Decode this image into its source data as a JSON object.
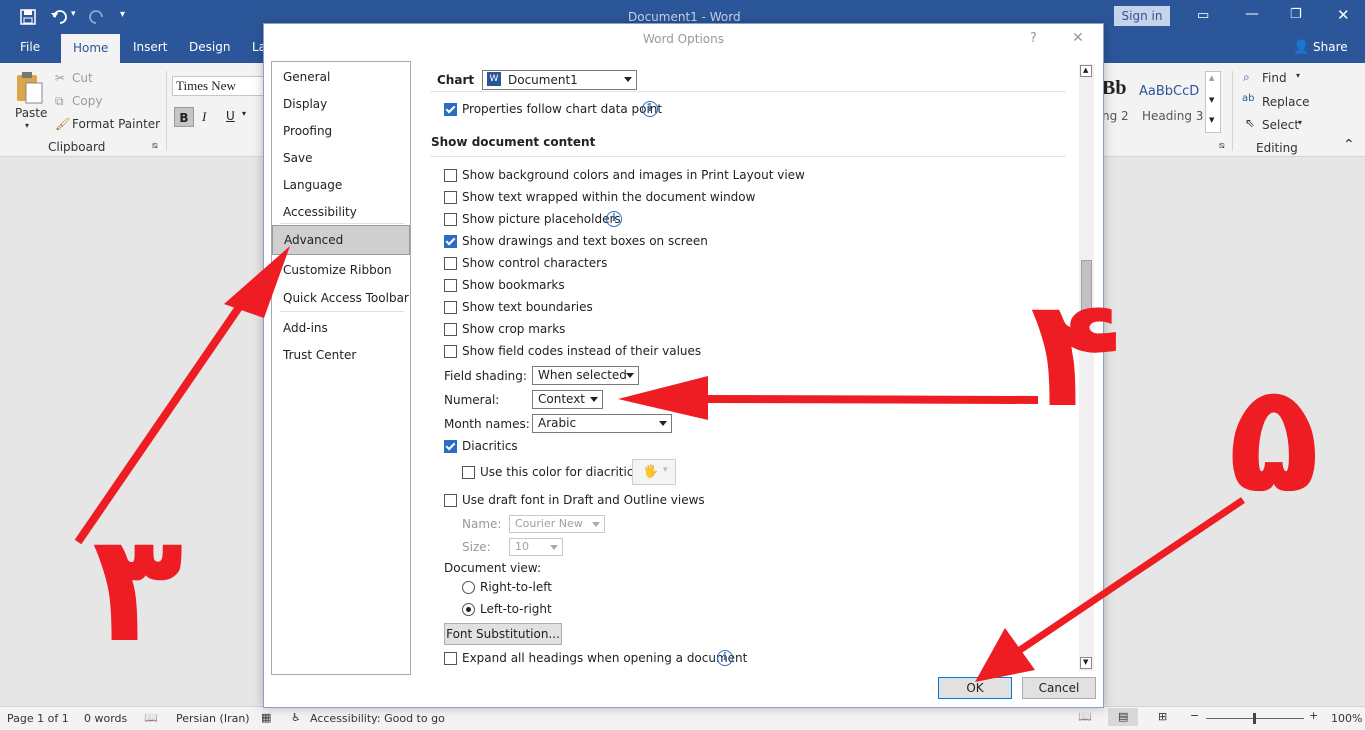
{
  "titlebar": {
    "title": "Document1  -  Word",
    "sign_in": "Sign in"
  },
  "tabs": [
    "File",
    "Home",
    "Insert",
    "Design",
    "La"
  ],
  "share": "Share",
  "ribbon": {
    "paste": "Paste",
    "cut": "Cut",
    "copy": "Copy",
    "format_painter": "Format Painter",
    "clipboard": "Clipboard",
    "font_name": "Times New Rom",
    "bold": "B",
    "italic": "I",
    "underline": "U",
    "style_big": "Bb",
    "style_sample": "AaBbCcD",
    "style_2": "ng 2",
    "style_3": "Heading 3",
    "find": "Find",
    "replace": "Replace",
    "select": "Select",
    "editing": "Editing"
  },
  "dialog": {
    "title": "Word Options",
    "help": "?",
    "close": "✕",
    "nav": [
      "General",
      "Display",
      "Proofing",
      "Save",
      "Language",
      "Accessibility",
      "Advanced",
      "Customize Ribbon",
      "Quick Access Toolbar",
      "Add-ins",
      "Trust Center"
    ],
    "selected_nav": "Advanced",
    "chart_label": "Chart",
    "chart_value": "Document1",
    "properties_follow": "Properties follow chart data point",
    "section_header": "Show document content",
    "options": [
      {
        "label": "Show background colors and images in Print Layout view",
        "checked": false
      },
      {
        "label": "Show text wrapped within the document window",
        "checked": false
      },
      {
        "label": "Show picture placeholders",
        "checked": false
      },
      {
        "label": "Show drawings and text boxes on screen",
        "checked": true
      },
      {
        "label": "Show control characters",
        "checked": false
      },
      {
        "label": "Show bookmarks",
        "checked": false
      },
      {
        "label": "Show text boundaries",
        "checked": false
      },
      {
        "label": "Show crop marks",
        "checked": false
      },
      {
        "label": "Show field codes instead of their values",
        "checked": false
      }
    ],
    "field_shading_label": "Field shading:",
    "field_shading_value": "When selected",
    "numeral_label": "Numeral:",
    "numeral_value": "Context",
    "month_names_label": "Month names:",
    "month_names_value": "Arabic",
    "diacritics": "Diacritics",
    "use_color_diacritics": "Use this color for diacritics",
    "draft_font": "Use draft font in Draft and Outline views",
    "name_label": "Name:",
    "name_value": "Courier New",
    "size_label": "Size:",
    "size_value": "10",
    "document_view": "Document view:",
    "rtl": "Right-to-left",
    "ltr": "Left-to-right",
    "font_subst": "Font Substitution...",
    "expand_headings": "Expand all headings when opening a document",
    "ok": "OK",
    "cancel": "Cancel"
  },
  "status": {
    "page": "Page 1 of 1",
    "words": "0 words",
    "language": "Persian (Iran)",
    "accessibility": "Accessibility: Good to go",
    "zoom": "100%"
  },
  "annotations": [
    "۳",
    "۴",
    "۵"
  ],
  "colors": {
    "word_blue": "#2b579a",
    "annotation_red": "#ee1d23"
  }
}
